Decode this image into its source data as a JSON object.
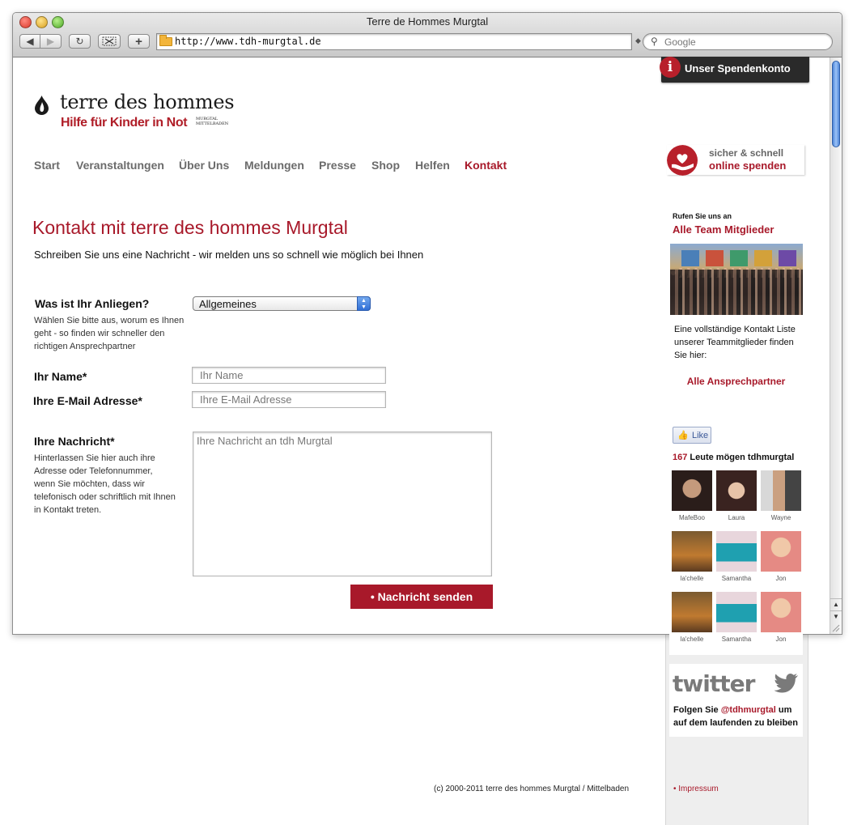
{
  "browser": {
    "window_title": "Terre de Hommes Murgtal",
    "url": "http://www.tdh-murgtal.de",
    "search_placeholder": "Google"
  },
  "logo": {
    "main": "terre des hommes",
    "sub": "Hilfe für Kinder in Not",
    "region_line1": "MURGTAL",
    "region_line2": "MITTELBADEN"
  },
  "nav": {
    "items": [
      "Start",
      "Veranstaltungen",
      "Über Uns",
      "Meldungen",
      "Presse",
      "Shop",
      "Helfen",
      "Kontakt"
    ],
    "active": "Kontakt"
  },
  "page": {
    "title": "Kontakt mit terre des hommes Murgtal",
    "intro": "Schreiben Sie uns eine Nachricht - wir melden uns so schnell wie möglich bei Ihnen"
  },
  "form": {
    "concern_label": "Was ist Ihr Anliegen?",
    "concern_hint": "Wählen Sie bitte aus, worum es Ihnen geht - so finden wir schneller den richtigen Ansprechpartner",
    "concern_value": "Allgemeines",
    "name_label": "Ihr Name*",
    "name_placeholder": "Ihr Name",
    "email_label": "Ihre E-Mail Adresse*",
    "email_placeholder": "Ihre E-Mail Adresse",
    "message_label": "Ihre Nachricht*",
    "message_hint": "Hinterlassen Sie hier auch ihre Adresse oder Telefonnummer, wenn Sie möchten, dass wir telefonisch oder schriftlich mit Ihnen in Kontakt treten.",
    "message_placeholder": "Ihre Nachricht an tdh Murgtal",
    "submit_label": "• Nachricht senden"
  },
  "sidebar": {
    "account_label": "Unser Spendenkonto",
    "donate_top": "sicher & schnell",
    "donate_bottom": "online spenden",
    "call_small": "Rufen Sie uns an",
    "call_team": "Alle Team Mitglieder",
    "team_desc": "Eine vollständige Kontakt Liste unserer Teammitglieder finden Sie hier:",
    "all_contacts": "Alle Ansprechpartner",
    "fb_like": "Like",
    "fb_count": "167",
    "fb_count_text": " Leute mögen tdhmurgtal",
    "fans": [
      "MafeBoo",
      "Laura",
      "Wayne",
      "la'chelle",
      "Samantha",
      "Jon",
      "la'chelle",
      "Samantha",
      "Jon"
    ],
    "twitter_logo": "twitter",
    "twitter_text_pre": "Folgen Sie ",
    "twitter_handle": "@tdhmurgtal",
    "twitter_text_post": " um auf dem laufenden zu bleiben"
  },
  "footer": {
    "copyright": "(c) 2000-2011 terre des hommes Murgtal / Mittelbaden",
    "impressum": "• Impressum"
  },
  "colors": {
    "brand_red": "#a8192a",
    "nav_gray": "#6b6b6b",
    "sidebar_bg": "#eeeeee"
  }
}
